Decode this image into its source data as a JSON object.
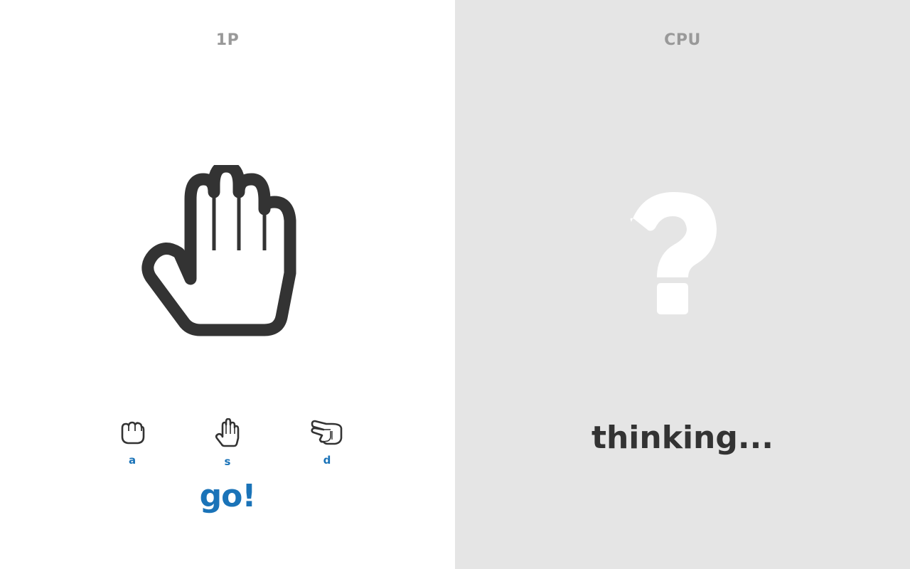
{
  "player": {
    "label": "1P",
    "current_hand": "paper",
    "current_hand_icon": "open-hand-icon",
    "choices": [
      {
        "name": "rock",
        "icon": "fist-icon",
        "key": "a"
      },
      {
        "name": "paper",
        "icon": "open-hand-icon",
        "key": "s"
      },
      {
        "name": "scissors",
        "icon": "scissors-hand-icon",
        "key": "d"
      }
    ],
    "prompt": "go!"
  },
  "cpu": {
    "label": "CPU",
    "hand_icon": "question-mark-icon",
    "status": "thinking..."
  },
  "colors": {
    "player_bg": "#ffffff",
    "cpu_bg": "#e5e5e5",
    "label": "#999999",
    "accent": "#1a73b8",
    "ink": "#333333",
    "question": "#ffffff"
  }
}
